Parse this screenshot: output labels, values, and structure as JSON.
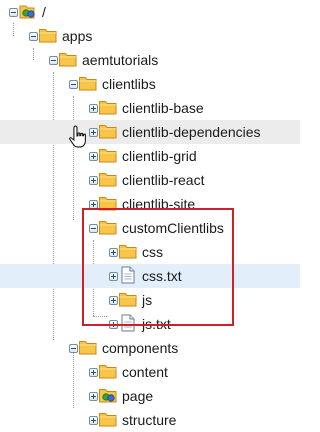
{
  "tree": {
    "root": {
      "label": "/"
    },
    "nodes": [
      {
        "label": "apps",
        "type": "folder",
        "state": "expanded"
      },
      {
        "label": "aemtutorials",
        "type": "folder",
        "state": "expanded"
      },
      {
        "label": "clientlibs",
        "type": "folder",
        "state": "expanded"
      },
      {
        "label": "clientlib-base",
        "type": "folder",
        "state": "collapsed"
      },
      {
        "label": "clientlib-dependencies",
        "type": "folder",
        "state": "collapsed",
        "hovered": true
      },
      {
        "label": "clientlib-grid",
        "type": "folder",
        "state": "collapsed"
      },
      {
        "label": "clientlib-react",
        "type": "folder",
        "state": "collapsed"
      },
      {
        "label": "clientlib-site",
        "type": "folder",
        "state": "collapsed"
      },
      {
        "label": "customClientlibs",
        "type": "folder",
        "state": "expanded"
      },
      {
        "label": "css",
        "type": "folder",
        "state": "collapsed"
      },
      {
        "label": "css.txt",
        "type": "file",
        "state": "collapsed",
        "selected": true
      },
      {
        "label": "js",
        "type": "folder",
        "state": "collapsed"
      },
      {
        "label": "js.txt",
        "type": "file",
        "state": "collapsed"
      },
      {
        "label": "components",
        "type": "folder",
        "state": "expanded"
      },
      {
        "label": "content",
        "type": "folder",
        "state": "collapsed"
      },
      {
        "label": "page",
        "type": "page-folder",
        "state": "collapsed"
      },
      {
        "label": "structure",
        "type": "folder",
        "state": "collapsed"
      }
    ]
  },
  "colors": {
    "hover_row": "#ececec",
    "selected_row": "#e2eef9",
    "highlight_border": "#c8232c",
    "folder_fill": "#f6c54a"
  },
  "icons": {
    "folder": "folder-icon",
    "file": "file-icon",
    "page": "page-folder-icon",
    "root": "repository-root-icon",
    "cursor": "hand-pointer-icon"
  }
}
